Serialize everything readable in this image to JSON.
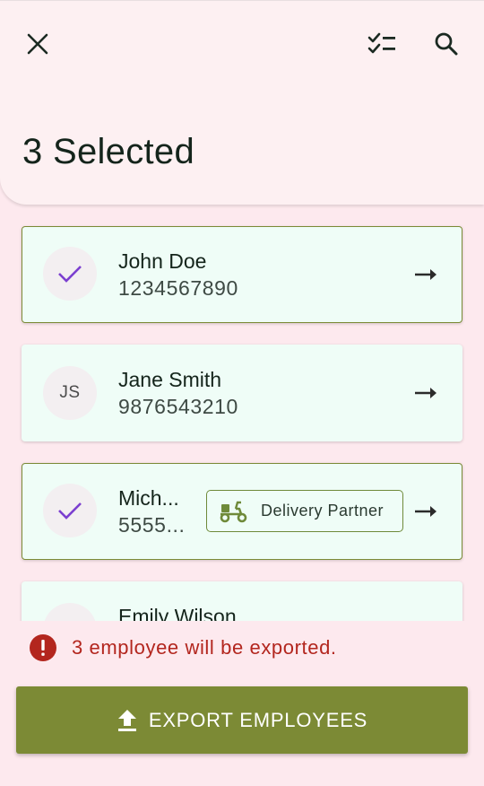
{
  "header": {
    "title": "3 Selected",
    "close_icon": "close-icon",
    "checklist_icon": "checklist-icon",
    "search_icon": "search-icon"
  },
  "employees": [
    {
      "name": "John Doe",
      "phone": "1234567890",
      "selected": true,
      "initials": ""
    },
    {
      "name": "Jane Smith",
      "phone": "9876543210",
      "selected": false,
      "initials": "JS"
    },
    {
      "name": "Mich...",
      "phone": "5555...",
      "selected": true,
      "initials": "",
      "tag": "Delivery Partner",
      "tag_icon": "scooter-icon"
    },
    {
      "name": "Emily Wilson",
      "phone": "",
      "selected": false,
      "initials": ""
    }
  ],
  "warning": {
    "text": "3 employee will be exported.",
    "icon": "error-icon",
    "color": "#b3261e"
  },
  "export_button": {
    "label": "EXPORT EMPLOYEES",
    "icon": "upload-icon"
  },
  "colors": {
    "accent": "#7c8a35",
    "check": "#7b3fd0",
    "card_bg": "#effdf7",
    "page_bg": "#fde9ee"
  }
}
